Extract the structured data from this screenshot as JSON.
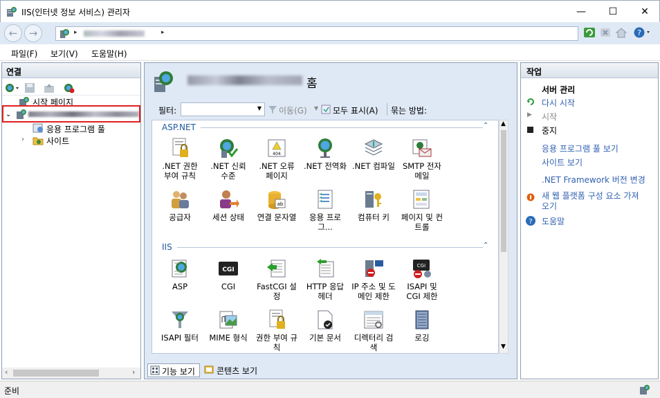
{
  "window": {
    "title": "IIS(인터넷 정보 서비스) 관리자",
    "minimize": "—",
    "maximize": "☐",
    "close": "✕"
  },
  "address": {
    "separator": "▸",
    "end_arrow": "▸"
  },
  "menu": {
    "items": [
      "파일(F)",
      "보기(V)",
      "도움말(H)"
    ]
  },
  "connections": {
    "header": "연결",
    "tree": {
      "start_page": "시작 페이지",
      "app_pools": "응용 프로그램 풀",
      "sites": "사이트"
    }
  },
  "center": {
    "home_suffix": "홈",
    "filter": {
      "label": "필터:",
      "go": "이동(G)",
      "show_all": "모두 표시(A)",
      "group_by": "묶는 방법:"
    },
    "groups": [
      {
        "name": "ASP.NET",
        "features": [
          ".NET 권한 부여 규칙",
          ".NET 신뢰 수준",
          ".NET 오류 페이지",
          ".NET 전역화",
          ".NET 컴파일",
          "SMTP 전자 메일",
          "공급자",
          "세션 상태",
          "연결 문자열",
          "응용 프로그...",
          "컴퓨터 키",
          "페이지 및 컨트롤"
        ]
      },
      {
        "name": "IIS",
        "features": [
          "ASP",
          "CGI",
          "FastCGI 설정",
          "HTTP 응답 헤더",
          "IP 주소 및 도메인 제한",
          "ISAPI 및 CGI 제한",
          "ISAPI 필터",
          "MIME 형식",
          "권한 부여 규칙",
          "기본 문서",
          "디렉터리 검색",
          "로깅"
        ]
      }
    ],
    "tabs": {
      "features_view": "기능 보기",
      "content_view": "콘텐츠 보기"
    }
  },
  "actions": {
    "header": "작업",
    "server_manage": "서버 관리",
    "restart": "다시 시작",
    "start": "시작",
    "stop": "중지",
    "view_app_pools": "응용 프로그램 풀 보기",
    "view_sites": "사이트 보기",
    "net_framework": ".NET Framework 버전 변경",
    "new_platform_1": "새 웹 플랫폼 구성 요소 가져",
    "new_platform_2": "오기",
    "help": "도움말"
  },
  "status": {
    "text": "준비"
  },
  "colors": {
    "link": "#3161b0",
    "highlight": "#e02020"
  }
}
